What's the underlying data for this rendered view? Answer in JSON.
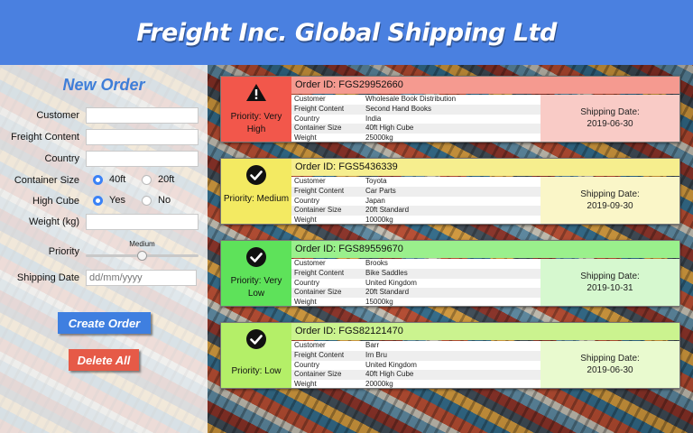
{
  "header": {
    "title": "Freight Inc. Global Shipping Ltd"
  },
  "form": {
    "title": "New Order",
    "customer_label": "Customer",
    "customer_value": "",
    "freight_label": "Freight Content",
    "freight_value": "",
    "country_label": "Country",
    "country_value": "",
    "container_label": "Container Size",
    "container_options": [
      "40ft",
      "20ft"
    ],
    "container_selected": "40ft",
    "highcube_label": "High Cube",
    "highcube_options": [
      "Yes",
      "No"
    ],
    "highcube_selected": "Yes",
    "weight_label": "Weight (kg)",
    "weight_value": "",
    "priority_label": "Priority",
    "priority_value": "Medium",
    "priority_level": 0.5,
    "date_label": "Shipping Date",
    "date_placeholder": "dd/mm/yyyy",
    "create_button": "Create Order",
    "delete_button": "Delete All"
  },
  "field_labels": [
    "Customer",
    "Freight Content",
    "Country",
    "Container Size",
    "Weight"
  ],
  "orders": [
    {
      "order_id": "Order ID: FGS29952660",
      "priority": "Priority: Very High",
      "icon": "warning-icon",
      "fields": [
        "Wholesale Book Distribution",
        "Second Hand Books",
        "India",
        "40ft High Cube",
        "25000kg"
      ],
      "ship_label": "Shipping Date:",
      "ship_date": "2019-06-30",
      "colors": {
        "pcol": "#f2574b",
        "hdr": "#f59a90",
        "ship": "#f9cbc6"
      }
    },
    {
      "order_id": "Order ID: FGS5436339",
      "priority": "Priority: Medium",
      "icon": "check-icon",
      "fields": [
        "Toyota",
        "Car Parts",
        "Japan",
        "20ft Standard",
        "10000kg"
      ],
      "ship_label": "Shipping Date:",
      "ship_date": "2019-09-30",
      "colors": {
        "pcol": "#f3ea62",
        "hdr": "#f6ee8e",
        "ship": "#faf6c8"
      }
    },
    {
      "order_id": "Order ID: FGS89559670",
      "priority": "Priority: Very Low",
      "icon": "check-icon",
      "fields": [
        "Brooks",
        "Bike Saddles",
        "United Kingdom",
        "20ft Standard",
        "15000kg"
      ],
      "ship_label": "Shipping Date:",
      "ship_date": "2019-10-31",
      "colors": {
        "pcol": "#5ee25a",
        "hdr": "#9af08c",
        "ship": "#d6f8cf"
      }
    },
    {
      "order_id": "Order ID: FGS82121470",
      "priority": "Priority: Low",
      "icon": "check-icon",
      "fields": [
        "Barr",
        "Irn Bru",
        "United Kingdom",
        "40ft High Cube",
        "20000kg"
      ],
      "ship_label": "Shipping Date:",
      "ship_date": "2019-06-30",
      "colors": {
        "pcol": "#b4ef68",
        "hdr": "#cbf38f",
        "ship": "#e9facf"
      }
    }
  ]
}
